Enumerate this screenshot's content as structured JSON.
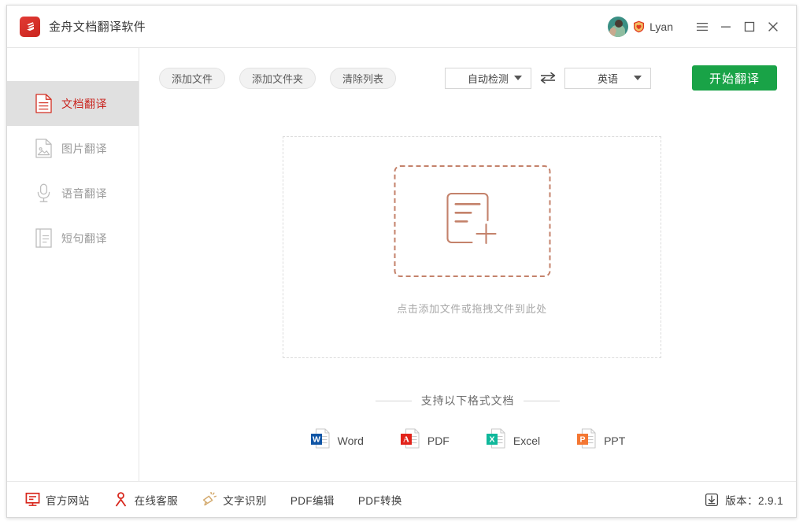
{
  "window": {
    "title": "金舟文档翻译软件",
    "logo_icon": "diamond-s-logo-icon"
  },
  "account": {
    "avatar_icon": "user-avatar",
    "vip_badge_icon": "vip-shield-icon",
    "username": "Lyan"
  },
  "window_controls": {
    "menu": "☰",
    "minimize": "−",
    "maximize": "□",
    "close": "✕"
  },
  "sidebar": {
    "items": [
      {
        "label": "文档翻译",
        "icon": "document-translate-icon",
        "active": true
      },
      {
        "label": "图片翻译",
        "icon": "image-translate-icon",
        "active": false
      },
      {
        "label": "语音翻译",
        "icon": "microphone-translate-icon",
        "active": false
      },
      {
        "label": "短句翻译",
        "icon": "short-text-translate-icon",
        "active": false
      }
    ]
  },
  "toolbar": {
    "add_file": "添加文件",
    "add_folder": "添加文件夹",
    "clear_list": "清除列表",
    "source_language": "自动检测",
    "target_language": "英语",
    "swap_icon": "swap-arrows-icon",
    "start_translate": "开始翻译",
    "start_translate_color": "#19a347"
  },
  "dropzone": {
    "icon": "document-add-icon",
    "hint": "点击添加文件或拖拽文件到此处",
    "border_color": "#c4826b"
  },
  "formats": {
    "title": "支持以下格式文档",
    "items": [
      {
        "name": "Word",
        "badge": "W",
        "color": "#1055a5",
        "icon": "word-file-icon"
      },
      {
        "name": "PDF",
        "badge": "A",
        "color": "#e2231a",
        "icon": "pdf-file-icon"
      },
      {
        "name": "Excel",
        "badge": "X",
        "color": "#0fb89b",
        "icon": "excel-file-icon"
      },
      {
        "name": "PPT",
        "badge": "P",
        "color": "#f47733",
        "icon": "ppt-file-icon"
      }
    ]
  },
  "bottombar": {
    "items": [
      {
        "label": "官方网站",
        "icon": "monitor-icon",
        "has_icon": true
      },
      {
        "label": "在线客服",
        "icon": "customer-service-person-icon",
        "has_icon": true
      },
      {
        "label": "文字识别",
        "icon": "megaphone-icon",
        "has_icon": true
      },
      {
        "label": "PDF编辑",
        "icon": "",
        "has_icon": false
      },
      {
        "label": "PDF转换",
        "icon": "",
        "has_icon": false
      }
    ],
    "version_icon": "download-icon",
    "version_label": "版本：2.9.1"
  }
}
